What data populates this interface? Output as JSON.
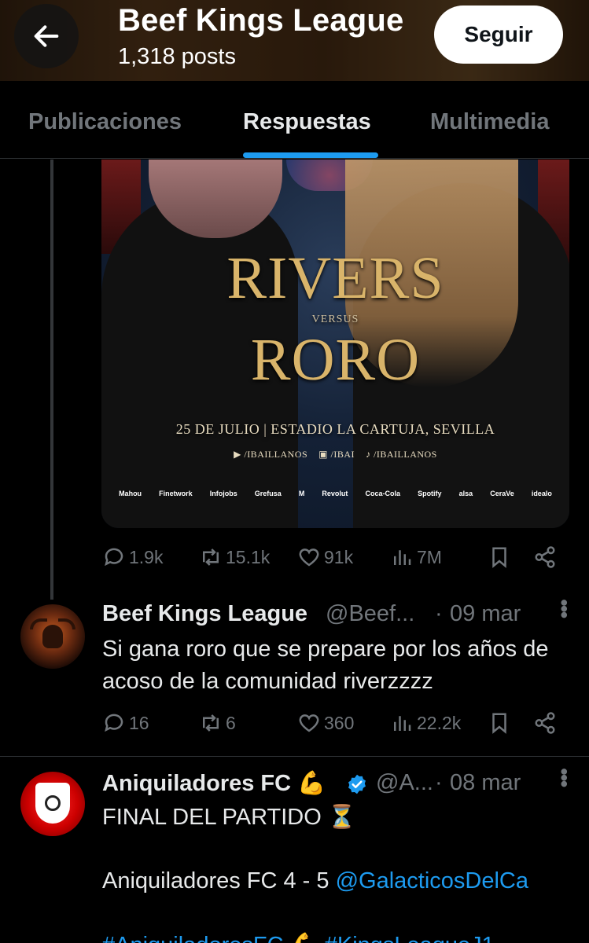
{
  "header": {
    "title": "Beef Kings League",
    "subtitle": "1,318 posts",
    "follow_label": "Seguir"
  },
  "tabs": [
    {
      "label": "Publicaciones",
      "active": false
    },
    {
      "label": "Respuestas",
      "active": true
    },
    {
      "label": "Multimedia",
      "active": false
    }
  ],
  "media": {
    "title_line1": "RIVERS",
    "versus": "VERSUS",
    "title_line2": "RORO",
    "event": "25 DE JULIO | ESTADIO LA CARTUJA, SEVILLA",
    "socials": [
      "▶ /IBAILLANOS",
      "▣ /IBAI",
      "♪ /IBAILLANOS"
    ],
    "sponsors": [
      "Mahou",
      "Finetwork",
      "Infojobs",
      "Grefusa",
      "M",
      "Revolut",
      "Coca-Cola",
      "Spotify",
      "alsa",
      "CeraVe",
      "idealo"
    ]
  },
  "post1_stats": {
    "replies": "1.9k",
    "reposts": "15.1k",
    "likes": "91k",
    "views": "7M"
  },
  "reply": {
    "name": "Beef Kings League",
    "handle": "@Beef...",
    "date": "09 mar",
    "text": "Si gana roro que se prepare por los años de acoso de la comunidad riverzzzz",
    "stats": {
      "replies": "16",
      "reposts": "6",
      "likes": "360",
      "views": "22.2k"
    }
  },
  "post2": {
    "name": "Aniquiladores FC 💪",
    "handle": "@A...",
    "date": "08 mar",
    "line1": "FINAL DEL PARTIDO ⏳",
    "line2_prefix": "Aniquiladores FC 4 - 5 ",
    "line2_link": "@GalacticosDelCa",
    "line3": "#AniquiladoresFC 💪 #KingsLeagueJ1"
  },
  "colors": {
    "accent": "#1d9bf0",
    "muted": "#71767b",
    "background": "#000000"
  }
}
